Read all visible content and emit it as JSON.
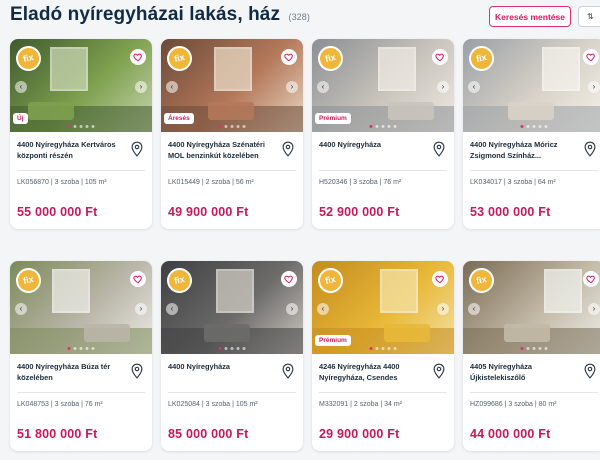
{
  "header": {
    "title": "Eladó nyíregyházai lakás, ház",
    "count": "(328)",
    "save_button": "Keresés mentése",
    "sort_button": "⇅"
  },
  "brand": {
    "logo_text": "fix"
  },
  "colors": {
    "accent": "#d6185e",
    "price": "#c8175a",
    "title": "#0f2b45"
  },
  "listings": [
    {
      "badge": "Új",
      "address": "4400 Nyíregyháza Kertváros központi részén",
      "meta": "LK056870 | 3 szoba | 105 m²",
      "price": "55 000 000 Ft",
      "photo": "garden with vine",
      "photo_colors": [
        "#3f5a2e",
        "#7ea04e",
        "#c8d6b2"
      ]
    },
    {
      "badge": "Áresés",
      "address": "4400 Nyíregyháza Szénatéri MOL benzinkút közelében",
      "meta": "LK015449 | 2 szoba | 56 m²",
      "price": "49 900 000 Ft",
      "photo": "living room with red curtains",
      "photo_colors": [
        "#6b4a38",
        "#b4785a",
        "#e8d9c4"
      ]
    },
    {
      "badge": "Prémium",
      "address": "4400 Nyíregyháza",
      "meta": "H520346 | 3 szoba | 76 m²",
      "price": "52 900 000 Ft",
      "photo": "white kitchen",
      "photo_colors": [
        "#8b8f93",
        "#c9c4bc",
        "#efeae3"
      ]
    },
    {
      "badge": "",
      "address": "4400 Nyíregyháza Móricz Zsigmond Színház...",
      "meta": "LK034017 | 3 szoba | 64 m²",
      "price": "53 000 000 Ft",
      "photo": "bright living room",
      "photo_colors": [
        "#9aa0a6",
        "#d8d2c8",
        "#f5f2ec"
      ]
    },
    {
      "badge": "",
      "address": "4400 Nyíregyháza Búza tér közelében",
      "meta": "LK048753 | 3 szoba | 76 m²",
      "price": "51 800 000 Ft",
      "photo": "kitchen with window",
      "photo_colors": [
        "#7c8a5a",
        "#b9b5a8",
        "#ecebe6"
      ]
    },
    {
      "badge": "",
      "address": "4400 Nyíregyháza",
      "meta": "LK025084 | 3 szoba | 105 m²",
      "price": "85 000 000 Ft",
      "photo": "grey sofa room",
      "photo_colors": [
        "#3f3f42",
        "#6c6b6a",
        "#cfcac2"
      ]
    },
    {
      "badge": "Prémium",
      "address": "4246 Nyíregyháza 4400 Nyíregyháza, Csendes",
      "meta": "M332091 | 2 szoba | 34 m²",
      "price": "29 900 000 Ft",
      "photo": "yellow wall room",
      "photo_colors": [
        "#c48a1e",
        "#e8b838",
        "#f3e2a6"
      ]
    },
    {
      "badge": "",
      "address": "4405 Nyíregyháza Újkistelekiszőlő",
      "meta": "HZ099686 | 3 szoba | 80 m²",
      "price": "44 000 000 Ft",
      "photo": "bright room with windows",
      "photo_colors": [
        "#7a6b55",
        "#c2b9a6",
        "#eef0ec"
      ]
    }
  ],
  "icons": {
    "favorite": "heart-icon",
    "location": "map-pin-icon",
    "prev": "chevron-left-icon",
    "next": "chevron-right-icon"
  }
}
